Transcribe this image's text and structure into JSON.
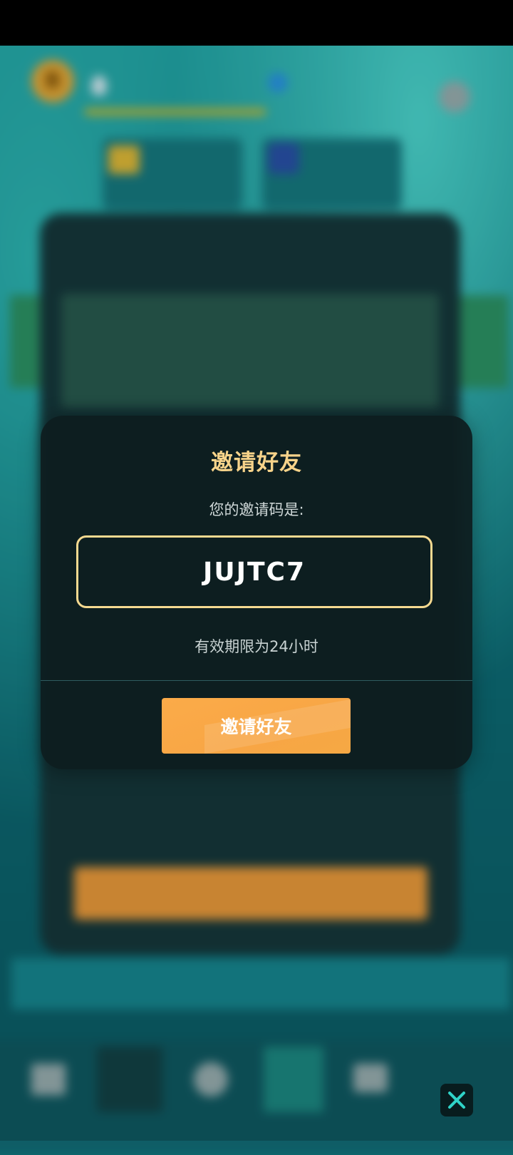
{
  "invite_modal": {
    "title": "邀请好友",
    "code_label": "您的邀请码是:",
    "invite_code": "JUJTC7",
    "validity_text": "有效期限为24小时",
    "invite_button_label": "邀请好友"
  },
  "nav": {
    "close_icon": "close-icon"
  },
  "colors": {
    "title": "#f7d38a",
    "code_border": "#f5d990",
    "button": "#f8a645",
    "close_icon": "#2fd3c8"
  }
}
